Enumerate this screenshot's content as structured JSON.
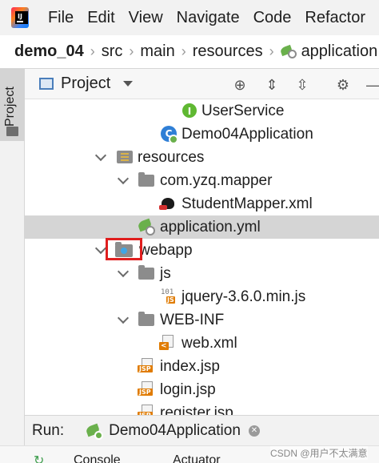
{
  "menubar": {
    "items": [
      "File",
      "Edit",
      "View",
      "Navigate",
      "Code",
      "Refactor"
    ]
  },
  "breadcrumb": {
    "items": [
      "demo_04",
      "src",
      "main",
      "resources",
      "application"
    ]
  },
  "side_stripe": {
    "project_tab": "Project"
  },
  "project_panel": {
    "title": "Project"
  },
  "tree": {
    "rows": [
      {
        "label": "UserService",
        "icon": "interface-icon"
      },
      {
        "label": "Demo04Application",
        "icon": "spring-boot-class-icon"
      },
      {
        "label": "resources",
        "icon": "resources-folder-icon"
      },
      {
        "label": "com.yzq.mapper",
        "icon": "folder-icon"
      },
      {
        "label": "StudentMapper.xml",
        "icon": "mybatis-mapper-icon"
      },
      {
        "label": "application.yml",
        "icon": "spring-config-icon"
      },
      {
        "label": "webapp",
        "icon": "web-folder-icon"
      },
      {
        "label": "js",
        "icon": "folder-icon"
      },
      {
        "label": "jquery-3.6.0.min.js",
        "icon": "js-file-icon"
      },
      {
        "label": "WEB-INF",
        "icon": "folder-icon"
      },
      {
        "label": "web.xml",
        "icon": "xml-file-icon"
      },
      {
        "label": "index.jsp",
        "icon": "jsp-file-icon"
      },
      {
        "label": "login.jsp",
        "icon": "jsp-file-icon"
      },
      {
        "label": "register.jsp",
        "icon": "jsp-file-icon"
      }
    ]
  },
  "runbar": {
    "label": "Run:",
    "tab": "Demo04Application"
  },
  "bottom": {
    "tabs": [
      "Console",
      "Actuator"
    ]
  },
  "watermark": "CSDN @用户不太满意"
}
